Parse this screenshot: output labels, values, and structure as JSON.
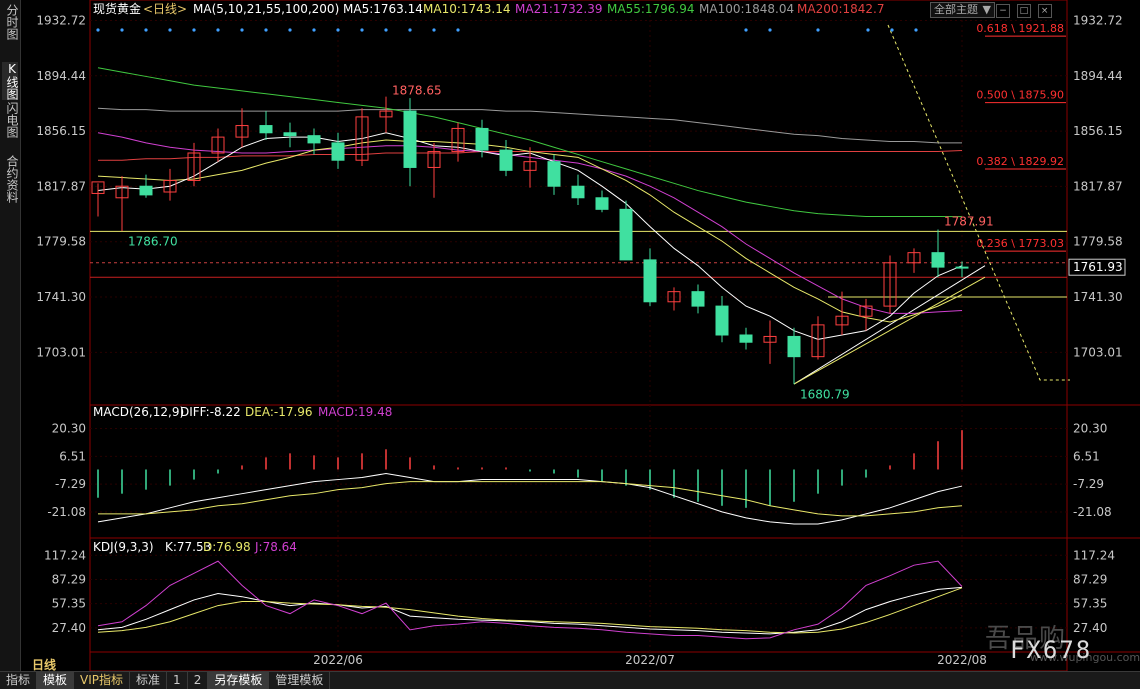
{
  "sidebar": {
    "items": [
      "分时图",
      "K线图",
      "闪电图",
      "合约资料"
    ]
  },
  "header": {
    "instrument": "现货黄金",
    "period_tag": "<日线>",
    "ma_params": "MA(5,10,21,55,100,200)",
    "ma_values": [
      {
        "label": "MA5:1763.14",
        "color": "#ffffff"
      },
      {
        "label": "MA10:1743.14",
        "color": "#e8e86a"
      },
      {
        "label": "MA21:1732.39",
        "color": "#d040d0"
      },
      {
        "label": "MA55:1796.94",
        "color": "#40c840"
      },
      {
        "label": "MA100:1848.04",
        "color": "#9a9a9a"
      },
      {
        "label": "MA200:1842.7",
        "color": "#e04040"
      }
    ]
  },
  "toolbar": {
    "theme_label": "全部主题",
    "theme_arrow": "▼"
  },
  "macd": {
    "title": "MACD(26,12,9)",
    "diff": "DIFF:-8.22",
    "dea": "DEA:-17.96",
    "macd": "MACD:19.48"
  },
  "kdj": {
    "title": "KDJ(9,3,3)",
    "k": "K:77.53",
    "d": "D:76.98",
    "j": "J:78.64"
  },
  "bottom_bar": {
    "tabs": [
      "指标",
      "模板",
      "VIP指标",
      "标准",
      "1",
      "2",
      "另存模板",
      "管理模板"
    ],
    "active": "模板"
  },
  "period_label": "日线",
  "watermark": {
    "brand": "吾品购",
    "site": "www.wupingou.com",
    "code": "FX678"
  },
  "colors": {
    "up": "#ff4040",
    "down": "#40e0a0",
    "grid": "#2a0000",
    "axis": "#8b0000"
  },
  "chart_data": {
    "type": "candlestick",
    "title": "现货黄金 日线",
    "price_axis": {
      "ticks": [
        1932.72,
        1894.44,
        1856.15,
        1817.87,
        1779.58,
        1741.3,
        1703.01
      ],
      "ylim": [
        1670,
        1940
      ]
    },
    "macd_axis": {
      "ticks": [
        20.3,
        6.51,
        -7.29,
        -21.08
      ],
      "ylim": [
        -30,
        27
      ]
    },
    "kdj_axis": {
      "ticks": [
        117.24,
        87.29,
        57.35,
        27.4
      ],
      "ylim": [
        0,
        130
      ]
    },
    "x_labels": [
      {
        "index": 10,
        "label": "2022/06"
      },
      {
        "index": 23,
        "label": "2022/07"
      },
      {
        "index": 36,
        "label": "2022/08"
      }
    ],
    "last_price": 1761.93,
    "annotations": [
      {
        "label": "1878.65",
        "index": 12,
        "price": 1878.65,
        "color": "#ff6060"
      },
      {
        "label": "1786.70",
        "index": 1,
        "price": 1786.7,
        "color": "#40e0a0"
      },
      {
        "label": "1680.79",
        "index": 29,
        "price": 1680.79,
        "color": "#40e0a0"
      },
      {
        "label": "1787.91",
        "index": 35,
        "price": 1787.91,
        "color": "#ff6060"
      }
    ],
    "fib_levels": [
      {
        "label": "0.618 \\ 1921.88",
        "price": 1921.88
      },
      {
        "label": "0.500 \\ 1875.90",
        "price": 1875.9
      },
      {
        "label": "0.382 \\ 1829.92",
        "price": 1829.92
      },
      {
        "label": "0.236 \\ 1773.03",
        "price": 1773.03
      }
    ],
    "candles": [
      {
        "o": 1813,
        "h": 1820,
        "l": 1797,
        "c": 1821
      },
      {
        "o": 1810,
        "h": 1825,
        "l": 1787,
        "c": 1818
      },
      {
        "o": 1818,
        "h": 1826,
        "l": 1810,
        "c": 1812
      },
      {
        "o": 1814,
        "h": 1830,
        "l": 1808,
        "c": 1822
      },
      {
        "o": 1822,
        "h": 1848,
        "l": 1818,
        "c": 1841
      },
      {
        "o": 1841,
        "h": 1858,
        "l": 1835,
        "c": 1852
      },
      {
        "o": 1852,
        "h": 1872,
        "l": 1845,
        "c": 1860
      },
      {
        "o": 1860,
        "h": 1870,
        "l": 1850,
        "c": 1855
      },
      {
        "o": 1855,
        "h": 1862,
        "l": 1845,
        "c": 1853
      },
      {
        "o": 1853,
        "h": 1858,
        "l": 1840,
        "c": 1848
      },
      {
        "o": 1848,
        "h": 1855,
        "l": 1830,
        "c": 1836
      },
      {
        "o": 1836,
        "h": 1872,
        "l": 1832,
        "c": 1866
      },
      {
        "o": 1866,
        "h": 1880,
        "l": 1855,
        "c": 1870
      },
      {
        "o": 1870,
        "h": 1879,
        "l": 1818,
        "c": 1831
      },
      {
        "o": 1831,
        "h": 1848,
        "l": 1810,
        "c": 1842
      },
      {
        "o": 1842,
        "h": 1862,
        "l": 1835,
        "c": 1858
      },
      {
        "o": 1858,
        "h": 1864,
        "l": 1838,
        "c": 1843
      },
      {
        "o": 1843,
        "h": 1850,
        "l": 1825,
        "c": 1829
      },
      {
        "o": 1829,
        "h": 1845,
        "l": 1817,
        "c": 1835
      },
      {
        "o": 1835,
        "h": 1840,
        "l": 1812,
        "c": 1818
      },
      {
        "o": 1818,
        "h": 1826,
        "l": 1805,
        "c": 1810
      },
      {
        "o": 1810,
        "h": 1815,
        "l": 1800,
        "c": 1802
      },
      {
        "o": 1802,
        "h": 1808,
        "l": 1770,
        "c": 1767
      },
      {
        "o": 1767,
        "h": 1775,
        "l": 1735,
        "c": 1738
      },
      {
        "o": 1738,
        "h": 1748,
        "l": 1732,
        "c": 1745
      },
      {
        "o": 1745,
        "h": 1750,
        "l": 1730,
        "c": 1735
      },
      {
        "o": 1735,
        "h": 1742,
        "l": 1710,
        "c": 1715
      },
      {
        "o": 1715,
        "h": 1720,
        "l": 1705,
        "c": 1710
      },
      {
        "o": 1710,
        "h": 1725,
        "l": 1695,
        "c": 1714
      },
      {
        "o": 1714,
        "h": 1720,
        "l": 1681,
        "c": 1700
      },
      {
        "o": 1700,
        "h": 1728,
        "l": 1698,
        "c": 1722
      },
      {
        "o": 1722,
        "h": 1745,
        "l": 1715,
        "c": 1728
      },
      {
        "o": 1728,
        "h": 1740,
        "l": 1718,
        "c": 1735
      },
      {
        "o": 1735,
        "h": 1770,
        "l": 1730,
        "c": 1765
      },
      {
        "o": 1765,
        "h": 1775,
        "l": 1758,
        "c": 1772
      },
      {
        "o": 1772,
        "h": 1788,
        "l": 1755,
        "c": 1762
      },
      {
        "o": 1762,
        "h": 1766,
        "l": 1755,
        "c": 1761.93
      }
    ],
    "ma5": [
      1815,
      1817,
      1816,
      1818,
      1825,
      1835,
      1845,
      1851,
      1852,
      1852,
      1849,
      1851,
      1855,
      1851,
      1846,
      1845,
      1842,
      1839,
      1841,
      1835,
      1829,
      1818,
      1806,
      1790,
      1775,
      1763,
      1748,
      1735,
      1728,
      1718,
      1712,
      1715,
      1718,
      1728,
      1744,
      1756,
      1763
    ],
    "ma10": [
      1825,
      1824,
      1823,
      1822,
      1823,
      1826,
      1829,
      1834,
      1838,
      1843,
      1845,
      1848,
      1850,
      1849,
      1849,
      1848,
      1847,
      1845,
      1842,
      1840,
      1838,
      1830,
      1822,
      1812,
      1800,
      1790,
      1780,
      1768,
      1758,
      1748,
      1740,
      1731,
      1727,
      1724,
      1729,
      1735,
      1743
    ],
    "ma21": [
      1855,
      1852,
      1848,
      1845,
      1843,
      1842,
      1841,
      1841,
      1842,
      1843,
      1844,
      1845,
      1846,
      1846,
      1845,
      1843,
      1842,
      1840,
      1838,
      1836,
      1834,
      1830,
      1825,
      1818,
      1810,
      1800,
      1790,
      1778,
      1768,
      1758,
      1749,
      1740,
      1734,
      1730,
      1730,
      1731,
      1732
    ],
    "ma55": [
      1900,
      1897,
      1894,
      1891,
      1888,
      1886,
      1884,
      1882,
      1880,
      1878,
      1876,
      1874,
      1872,
      1869,
      1866,
      1862,
      1858,
      1854,
      1850,
      1845,
      1840,
      1835,
      1830,
      1825,
      1820,
      1815,
      1811,
      1807,
      1804,
      1801,
      1799,
      1798,
      1797,
      1797,
      1797,
      1797,
      1796.94
    ],
    "ma100": [
      1872,
      1871,
      1871,
      1870,
      1870,
      1870,
      1870,
      1870,
      1870,
      1870,
      1870,
      1871,
      1871,
      1871,
      1871,
      1871,
      1871,
      1870,
      1870,
      1869,
      1868,
      1867,
      1866,
      1865,
      1864,
      1862,
      1860,
      1858,
      1856,
      1854,
      1853,
      1851,
      1850,
      1849,
      1849,
      1848,
      1848.04
    ],
    "ma200": [
      1836,
      1836,
      1837,
      1837,
      1838,
      1838,
      1839,
      1839,
      1839,
      1840,
      1840,
      1840,
      1841,
      1841,
      1841,
      1841,
      1842,
      1842,
      1842,
      1842,
      1842,
      1842,
      1842,
      1842,
      1842,
      1842,
      1842,
      1842,
      1842,
      1842,
      1842,
      1842,
      1842,
      1842,
      1842,
      1842,
      1842.7
    ],
    "macd_hist": [
      -14,
      -12,
      -10,
      -8,
      -5,
      -2,
      2,
      6,
      8,
      7,
      6,
      8,
      10,
      6,
      2,
      1,
      1,
      1,
      -1,
      -2,
      -4,
      -6,
      -8,
      -10,
      -14,
      -16,
      -18,
      -19,
      -18,
      -16,
      -12,
      -8,
      -4,
      2,
      8,
      14,
      19.48
    ],
    "dif": [
      -26,
      -24,
      -22,
      -19,
      -16,
      -14,
      -12,
      -10,
      -8,
      -6,
      -5,
      -4,
      -2,
      -4,
      -6,
      -6,
      -5,
      -5,
      -5,
      -5,
      -5,
      -6,
      -7,
      -9,
      -13,
      -17,
      -21,
      -24,
      -26,
      -27,
      -27,
      -25,
      -22,
      -19,
      -15,
      -11,
      -8.22
    ],
    "dea": [
      -22,
      -22,
      -22,
      -21,
      -20,
      -18,
      -17,
      -15,
      -13,
      -12,
      -10,
      -9,
      -7,
      -6,
      -6,
      -6,
      -6,
      -6,
      -6,
      -6,
      -6,
      -6,
      -7,
      -8,
      -9,
      -11,
      -13,
      -15,
      -18,
      -20,
      -22,
      -23,
      -23,
      -22,
      -21,
      -19,
      -17.96
    ],
    "k": [
      25,
      28,
      38,
      50,
      62,
      70,
      66,
      60,
      55,
      58,
      56,
      52,
      54,
      42,
      40,
      38,
      37,
      36,
      35,
      33,
      32,
      30,
      28,
      26,
      25,
      24,
      22,
      21,
      20,
      22,
      25,
      35,
      50,
      60,
      68,
      75,
      77.53
    ],
    "d": [
      22,
      24,
      28,
      35,
      45,
      55,
      60,
      60,
      58,
      57,
      56,
      54,
      53,
      50,
      46,
      42,
      39,
      37,
      36,
      35,
      34,
      33,
      31,
      29,
      28,
      27,
      25,
      24,
      22,
      21,
      22,
      26,
      34,
      44,
      55,
      66,
      76.98
    ],
    "j": [
      30,
      35,
      55,
      80,
      95,
      110,
      80,
      55,
      45,
      62,
      55,
      45,
      58,
      25,
      30,
      32,
      35,
      33,
      30,
      28,
      27,
      25,
      22,
      20,
      18,
      18,
      16,
      14,
      15,
      25,
      32,
      52,
      80,
      92,
      105,
      110,
      78.64
    ]
  }
}
